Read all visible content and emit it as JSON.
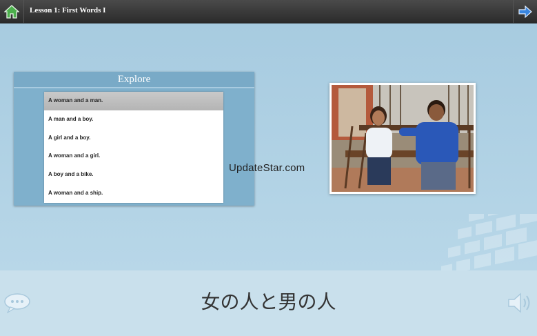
{
  "header": {
    "lesson_title": "Lesson 1: First Words I",
    "home_icon": "home-icon",
    "next_icon": "arrow-right-icon"
  },
  "explore": {
    "title": "Explore",
    "phrases": [
      "A woman and a man.",
      "A man and a boy.",
      "A girl and a boy.",
      "A woman and a girl.",
      "A boy and a bike.",
      "A woman and a ship."
    ],
    "selected_index": 0
  },
  "watermark": "UpdateStar.com",
  "footer": {
    "phrase_japanese": "女の人と男の人",
    "left_icon": "speech-bubble-icon",
    "right_icon": "speaker-icon"
  },
  "colors": {
    "background": "#a9cde0",
    "topbar": "#2b2b2b",
    "panel": "#7fb0cc",
    "home_icon": "#3a9a3a",
    "next_icon": "#3a7fd0"
  }
}
